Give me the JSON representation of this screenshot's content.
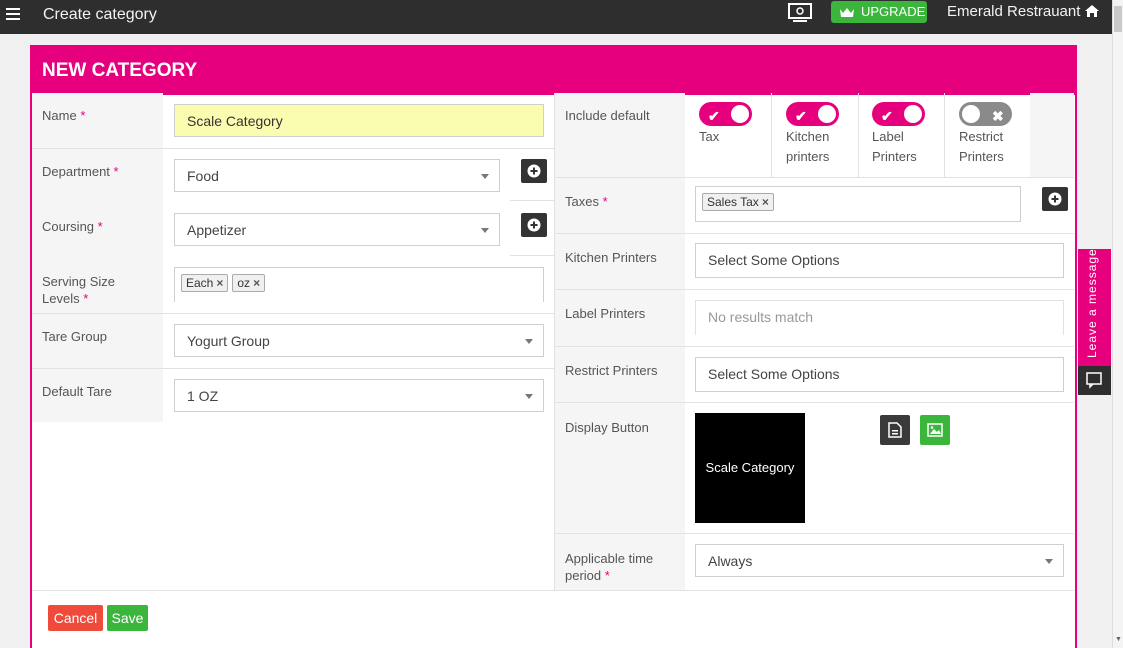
{
  "topbar": {
    "title": "Create category",
    "upgrade_label": "UPGRADE",
    "restaurant_name": "Emerald Restrauant"
  },
  "panel": {
    "title": "NEW CATEGORY"
  },
  "left_form": {
    "name": {
      "label": "Name",
      "required": "*",
      "value": "Scale Category"
    },
    "department": {
      "label": "Department",
      "required": "*",
      "value": "Food"
    },
    "coursing": {
      "label": "Coursing",
      "required": "*",
      "value": "Appetizer"
    },
    "serving_size": {
      "label_line1": "Serving Size",
      "label_line2": "Levels",
      "required": "*",
      "tags": [
        "Each",
        "oz"
      ]
    },
    "tare_group": {
      "label": "Tare Group",
      "value": "Yogurt Group"
    },
    "default_tare": {
      "label": "Default Tare",
      "value": "1 OZ"
    }
  },
  "right_form": {
    "include_default": {
      "label": "Include default",
      "toggles": [
        {
          "line1": "Tax",
          "line2": "",
          "state": "on"
        },
        {
          "line1": "Kitchen",
          "line2": "printers",
          "state": "on"
        },
        {
          "line1": "Label",
          "line2": "Printers",
          "state": "on"
        },
        {
          "line1": "Restrict",
          "line2": "Printers",
          "state": "off"
        }
      ]
    },
    "taxes": {
      "label": "Taxes",
      "required": "*",
      "tags": [
        "Sales Tax"
      ]
    },
    "kitchen_printers": {
      "label": "Kitchen Printers",
      "placeholder": "Select Some Options"
    },
    "label_printers": {
      "label": "Label Printers",
      "placeholder": "No results match"
    },
    "restrict_printers": {
      "label": "Restrict Printers",
      "placeholder": "Select Some Options"
    },
    "display_button": {
      "label": "Display Button",
      "preview_text": "Scale Category"
    },
    "time_period": {
      "label_line1": "Applicable time",
      "label_line2": "period",
      "required": "*",
      "value": "Always"
    }
  },
  "footer": {
    "cancel_label": "Cancel",
    "save_label": "Save"
  },
  "chat_widget": {
    "label": "Leave a message"
  },
  "colors": {
    "accent": "#e6007e",
    "success": "#3bb53b",
    "danger": "#f04a3a",
    "dark": "#2e2e2e"
  }
}
